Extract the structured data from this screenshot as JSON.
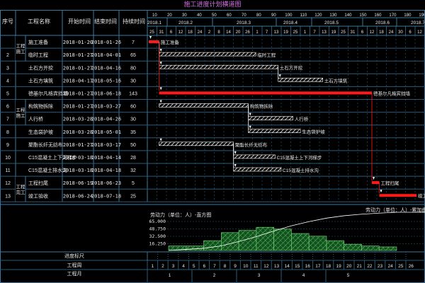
{
  "title": "施工进度计划横道图",
  "headers": {
    "no": "序号",
    "name": "工程名称",
    "start": "开始时间",
    "end": "结束时间",
    "duration": "持续时间"
  },
  "timeline": {
    "months": [
      "2018.1",
      "2018.2",
      "2018.3",
      "2018.4",
      "2018.5",
      "2018.6",
      "2018.7"
    ],
    "tick_top": [
      "10",
      "20",
      "30",
      "40",
      "50",
      "60",
      "70",
      "80",
      "90",
      "100",
      "110",
      "120",
      "130",
      "140",
      "150",
      "160",
      "170",
      "180",
      "190"
    ],
    "tick_bottom": [
      "25",
      "31",
      "6",
      "12",
      "18",
      "24",
      "2",
      "8",
      "14",
      "20",
      "26",
      "1",
      "7",
      "13",
      "19",
      "25",
      "1",
      "7",
      "13",
      "19",
      "25",
      "31",
      "6",
      "12",
      "18",
      "24",
      "30",
      "6",
      "12"
    ]
  },
  "groups": [
    {
      "label": "工程\n施工",
      "rows": [
        1,
        2
      ]
    },
    {
      "label": "工程\n施工",
      "rows": [
        6,
        7
      ]
    },
    {
      "label": "工程\n完工",
      "rows": [
        12,
        13
      ]
    }
  ],
  "tasks": [
    {
      "no": "",
      "name": "施工准备",
      "start": "2018-01-20",
      "end": "2018-01-26",
      "duration": "7",
      "label": "施工准备",
      "critical": true
    },
    {
      "no": "2",
      "name": "临时工程",
      "start": "2018-01-27",
      "end": "2018-04-01",
      "duration": "65",
      "label": "临时工程",
      "critical": false
    },
    {
      "no": "3",
      "name": "土石方开挖",
      "start": "2018-01-27",
      "end": "2018-04-16",
      "duration": "80",
      "label": "土石方开挖",
      "critical": false
    },
    {
      "no": "4",
      "name": "土石方填筑",
      "start": "2018-04-17",
      "end": "2018-05-16",
      "duration": "30",
      "label": "土石方填筑",
      "critical": false
    },
    {
      "no": "5",
      "name": "德基尔凡格宾挡墙",
      "start": "2018-01-27",
      "end": "2018-06-18",
      "duration": "143",
      "label": "德基尔凡格宾挡墙",
      "critical": true
    },
    {
      "no": "6",
      "name": "构筑物拆除",
      "start": "2018-01-27",
      "end": "2018-03-27",
      "duration": "60",
      "label": "构筑物拆除",
      "critical": false
    },
    {
      "no": "7",
      "name": "人行桥",
      "start": "2018-03-28",
      "end": "2018-04-26",
      "duration": "30",
      "label": "人行桥",
      "critical": false
    },
    {
      "no": "8",
      "name": "生态袋护坡",
      "start": "2018-03-28",
      "end": "2018-05-01",
      "duration": "35",
      "label": "生态袋护坡",
      "critical": false
    },
    {
      "no": "9",
      "name": "聚酯长纤无纺布",
      "start": "2018-01-27",
      "end": "2018-03-17",
      "duration": "50",
      "label": "聚酯长纤无纺布",
      "critical": false
    },
    {
      "no": "10",
      "name": "C15混凝土上下河梯步",
      "start": "2018-03-18",
      "end": "2018-04-14",
      "duration": "28",
      "label": "C15混凝土上下河梯步",
      "critical": false
    },
    {
      "no": "11",
      "name": "C15混凝土排水沟",
      "start": "2018-03-18",
      "end": "2018-04-18",
      "duration": "32",
      "label": "C15混凝土排水沟",
      "critical": false
    },
    {
      "no": "12",
      "name": "工程扫尾",
      "start": "2018-06-19",
      "end": "2018-06-23",
      "duration": "5",
      "label": "工程扫尾",
      "critical": true
    },
    {
      "no": "13",
      "name": "竣工验收",
      "start": "2018-06-24",
      "end": "2018-07-18",
      "duration": "25",
      "label": "竣工验收",
      "critical": true
    }
  ],
  "labor": {
    "title_hist": "劳动力（单位：人）-直方图",
    "title_curve": "劳动力（单位：人）-累加曲线",
    "y_labels": [
      "65.000",
      "48.750",
      "32.500",
      "16.250"
    ],
    "values": [
      10,
      10,
      22,
      40,
      45,
      52,
      48,
      38,
      32,
      22,
      14,
      10,
      8
    ],
    "curve_end_label": ""
  },
  "footer": {
    "row1_label": "进度标尺",
    "row2_label": "工程周",
    "row3_label": "工程月",
    "weeks": [
      "1",
      "2",
      "3",
      "4",
      "5",
      "6",
      "7",
      "8",
      "9",
      "10",
      "11",
      "12",
      "13",
      "14",
      "15",
      "16",
      "17",
      "18",
      "19",
      "20",
      "21",
      "22",
      "23",
      "24",
      "25",
      "26"
    ],
    "months": [
      "1",
      "2",
      "3",
      "4",
      "5"
    ]
  },
  "colors": {
    "grid": "#2c5a78",
    "grid_bright": "#3a7aa0",
    "title": "#d070e0",
    "text": "#e8e8e8",
    "critical": "#ff1a1a",
    "hatch_bg": "#ffffff",
    "labor_fill": "#1a6a2a",
    "labor_hatch": "#7ae07a"
  }
}
